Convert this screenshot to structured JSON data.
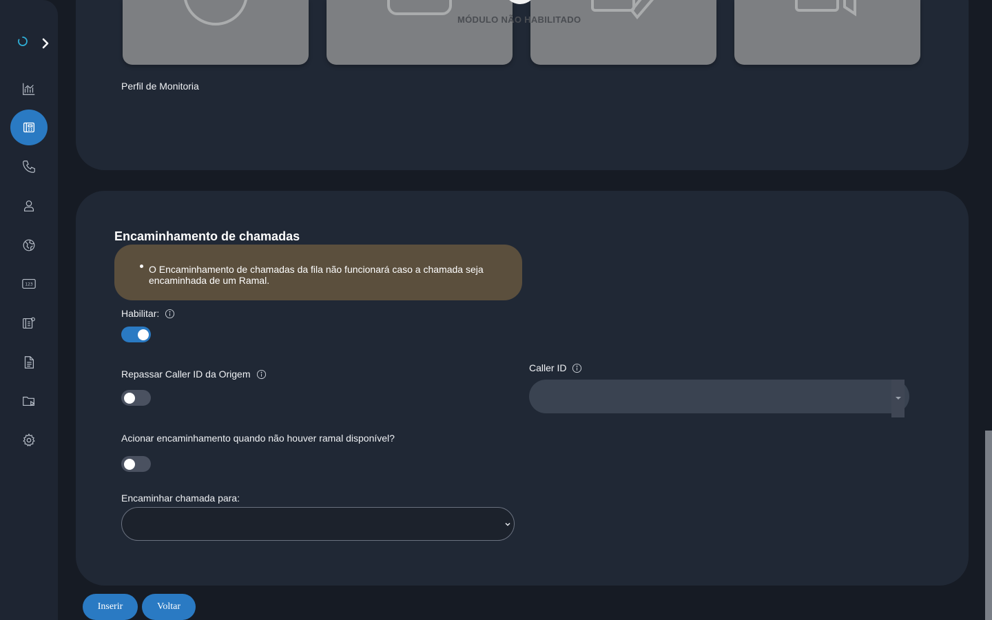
{
  "top_section": {
    "module_overlay": "MÓDULO NÃO HABILITADO",
    "profile_label": "Perfil de Monitoria"
  },
  "forwarding": {
    "title": "Encaminhamento de chamadas",
    "warning": "O Encaminhamento de chamadas da fila não funcionará caso a chamada seja encaminhada de um Ramal.",
    "enable_label": "Habilitar:",
    "enable_on": true,
    "pass_callerid_label": "Repassar Caller ID da Origem",
    "pass_callerid_on": false,
    "callerid_label": "Caller ID",
    "callerid_value": "",
    "no_extension_label": "Acionar encaminhamento quando não houver ramal disponível?",
    "no_extension_on": false,
    "forward_to_label": "Encaminhar chamada para:",
    "forward_to_value": ""
  },
  "buttons": {
    "insert": "Inserir",
    "back": "Voltar"
  },
  "colors": {
    "accent": "#2a7ac3",
    "background": "#161b24",
    "card": "#202835",
    "sidebar": "#1e2532",
    "warning_bg": "#5b4f3d"
  },
  "icons": {
    "sidebar": [
      "chart-icon",
      "queue-icon",
      "phone-icon",
      "user-icon",
      "globe-icon",
      "numbers-icon",
      "queue-settings-icon",
      "document-icon",
      "folder-play-icon",
      "gear-icon"
    ]
  }
}
